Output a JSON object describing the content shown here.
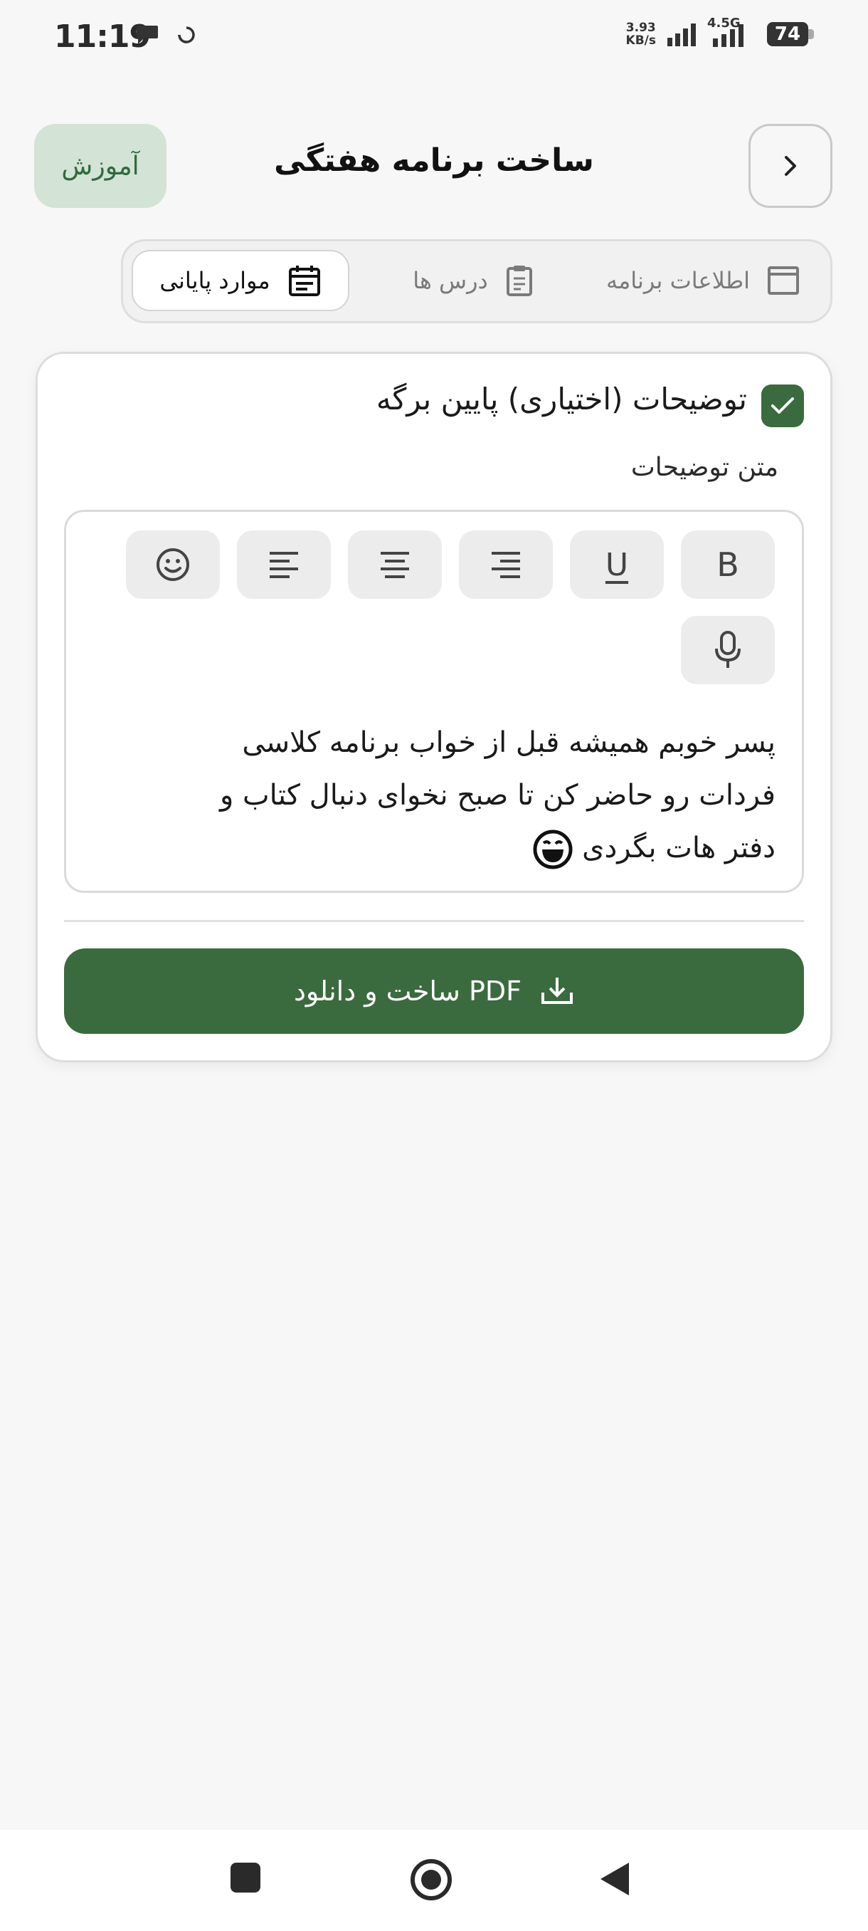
{
  "status_bar": {
    "time": "11:19",
    "net_speed_value": "3.93",
    "net_speed_unit": "KB/s",
    "network_type": "4.5G",
    "battery": "74"
  },
  "header": {
    "title": "ساخت برنامه هفتگی",
    "tutorial_label": "آموزش"
  },
  "tabs": [
    {
      "label": "اطلاعات برنامه",
      "icon": "window-icon"
    },
    {
      "label": "درس ها",
      "icon": "clipboard-icon"
    },
    {
      "label": "موارد پایانی",
      "icon": "calendar-icon",
      "active": true
    }
  ],
  "section": {
    "title": "توضیحات (اختیاری) پایین برگه",
    "checked": true,
    "field_label": "متن توضیحات"
  },
  "toolbar": {
    "bold": "B",
    "underline": "U"
  },
  "editor": {
    "line1": "پسر خوبم همیشه قبل از خواب برنامه کلاسی",
    "line2": "فردات رو حاضر کن تا صبح نخوای دنبال کتاب و",
    "line3": "دفتر هات بگردی"
  },
  "actions": {
    "pdf_label": "ساخت و دانلود PDF"
  },
  "colors": {
    "primary": "#3a6b3e",
    "tutorial_bg": "#d3e3d6"
  }
}
